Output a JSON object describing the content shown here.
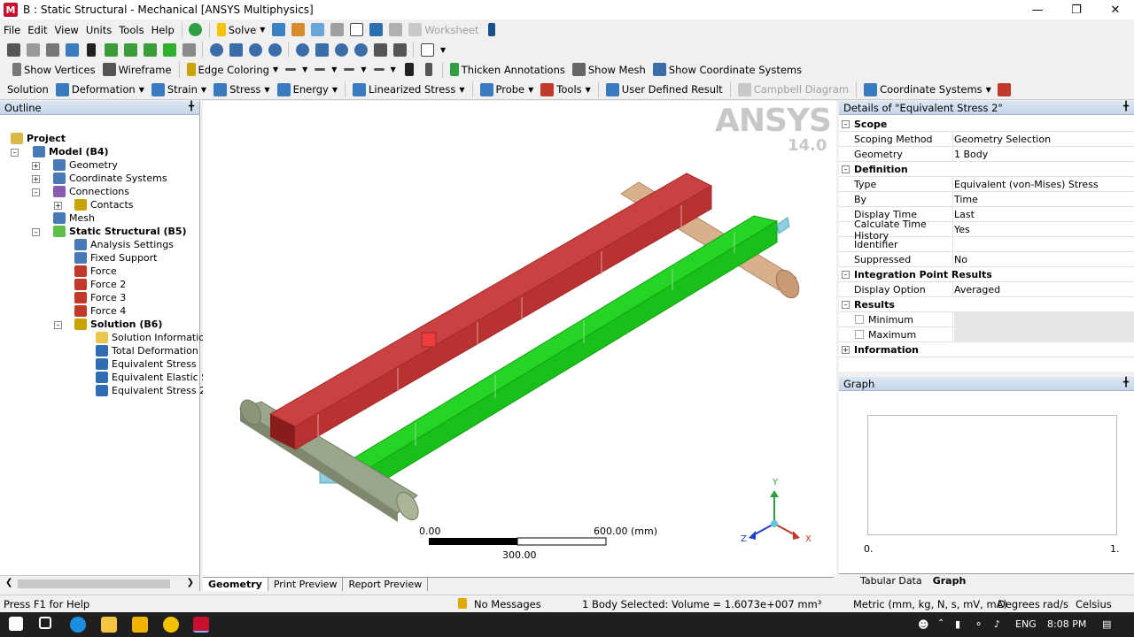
{
  "window": {
    "title": "B : Static Structural - Mechanical [ANSYS Multiphysics]",
    "app_letter": "M"
  },
  "menu": {
    "items": [
      "File",
      "Edit",
      "View",
      "Units",
      "Tools",
      "Help"
    ],
    "solve": "Solve",
    "worksheet": "Worksheet"
  },
  "toolbar3": {
    "show_vertices": "Show Vertices",
    "wireframe": "Wireframe",
    "edge_coloring": "Edge Coloring",
    "thicken": "Thicken Annotations",
    "show_mesh": "Show Mesh",
    "show_coord": "Show Coordinate Systems"
  },
  "toolbar4": {
    "solution": "Solution",
    "deformation": "Deformation",
    "strain": "Strain",
    "stress": "Stress",
    "energy": "Energy",
    "linearized": "Linearized Stress",
    "probe": "Probe",
    "tools": "Tools",
    "user_defined": "User Defined Result",
    "campbell": "Campbell Diagram",
    "coord": "Coordinate Systems"
  },
  "outline": {
    "title": "Outline",
    "items": [
      {
        "label": "Project"
      },
      {
        "label": "Model (B4)"
      },
      {
        "label": "Geometry"
      },
      {
        "label": "Coordinate Systems"
      },
      {
        "label": "Connections"
      },
      {
        "label": "Contacts"
      },
      {
        "label": "Mesh"
      },
      {
        "label": "Static Structural (B5)"
      },
      {
        "label": "Analysis Settings"
      },
      {
        "label": "Fixed Support"
      },
      {
        "label": "Force"
      },
      {
        "label": "Force 2"
      },
      {
        "label": "Force 3"
      },
      {
        "label": "Force 4"
      },
      {
        "label": "Solution (B6)"
      },
      {
        "label": "Solution Information"
      },
      {
        "label": "Total Deformation"
      },
      {
        "label": "Equivalent Stress"
      },
      {
        "label": "Equivalent Elastic St"
      },
      {
        "label": "Equivalent Stress 2"
      }
    ]
  },
  "viewport": {
    "logo": "ANSYS",
    "version": "14.0",
    "scale": {
      "zero": "0.00",
      "max": "600.00 (mm)",
      "mid": "300.00"
    },
    "axes": {
      "x": "X",
      "y": "Y",
      "z": "Z"
    }
  },
  "tabs": [
    "Geometry",
    "Print Preview",
    "Report Preview"
  ],
  "details": {
    "title": "Details of \"Equivalent Stress 2\"",
    "rows": [
      {
        "k": "Scope",
        "v": ""
      },
      {
        "k": "Scoping Method",
        "v": "Geometry Selection"
      },
      {
        "k": "Geometry",
        "v": "1 Body"
      },
      {
        "k": "Definition",
        "v": ""
      },
      {
        "k": "Type",
        "v": "Equivalent (von-Mises) Stress"
      },
      {
        "k": "By",
        "v": "Time"
      },
      {
        "k": "Display Time",
        "v": "Last"
      },
      {
        "k": "Calculate Time History",
        "v": "Yes"
      },
      {
        "k": "Identifier",
        "v": ""
      },
      {
        "k": "Suppressed",
        "v": "No"
      },
      {
        "k": "Integration Point Results",
        "v": ""
      },
      {
        "k": "Display Option",
        "v": "Averaged"
      },
      {
        "k": "Results",
        "v": ""
      },
      {
        "k": "Minimum",
        "v": ""
      },
      {
        "k": "Maximum",
        "v": ""
      },
      {
        "k": "Information",
        "v": ""
      }
    ]
  },
  "graph": {
    "title": "Graph",
    "x_min": "0.",
    "x_max": "1.",
    "tabs": [
      "Tabular Data",
      "Graph"
    ]
  },
  "status": {
    "help": "Press F1 for Help",
    "messages": "No Messages",
    "selection": "1 Body Selected: Volume = 1.6073e+007 mm³",
    "units": "Metric (mm, kg, N, s, mV, mA)",
    "angle": "Degrees",
    "rate": "rad/s",
    "temp": "Celsius"
  },
  "taskbar": {
    "lang": "ENG",
    "time": "8:08 PM"
  }
}
